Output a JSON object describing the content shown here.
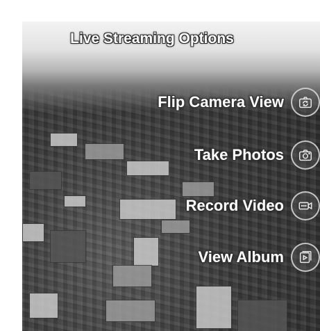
{
  "header": {
    "title": "Live Streaming Options"
  },
  "options": [
    {
      "label": "Flip Camera View",
      "icon": "flip-camera-icon"
    },
    {
      "label": "Take Photos",
      "icon": "camera-icon"
    },
    {
      "label": "Record Video",
      "icon": "video-camera-icon"
    },
    {
      "label": "View Album",
      "icon": "album-icon"
    }
  ]
}
